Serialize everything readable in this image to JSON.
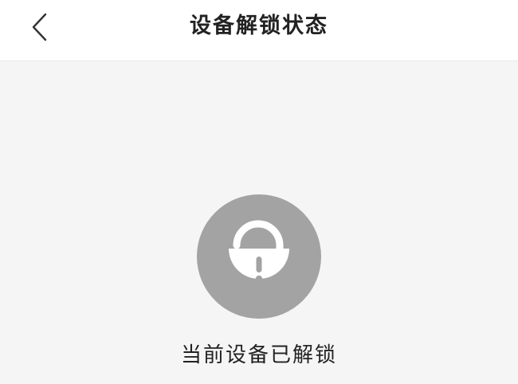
{
  "header": {
    "back_icon": "chevron-left-icon",
    "title": "设备解锁状态"
  },
  "status": {
    "icon": "unlocked-padlock-alert-icon",
    "message": "当前设备已解锁"
  },
  "colors": {
    "background": "#f5f5f5",
    "header_background": "#ffffff",
    "icon_circle": "#a3a3a3",
    "text": "#222222"
  }
}
